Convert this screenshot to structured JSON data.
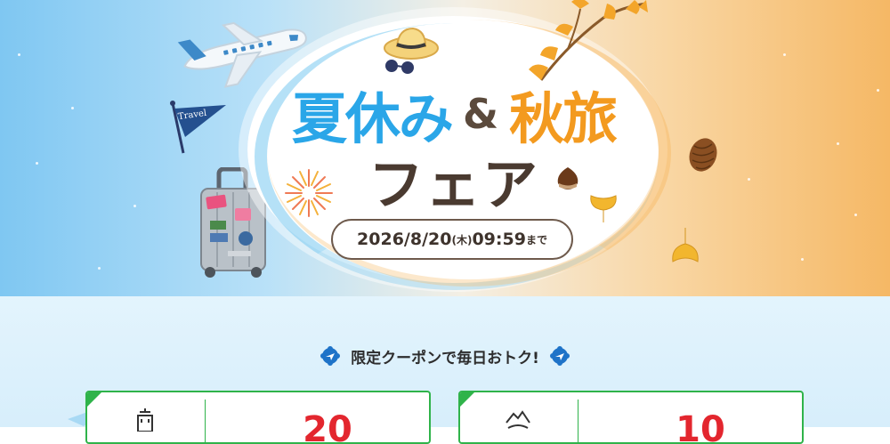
{
  "hero": {
    "title_part1": "夏休み",
    "title_amp": "&",
    "title_part2": "秋旅",
    "title_line2": "フェア",
    "date_main": "2026/8/20",
    "date_weekday": "(木)",
    "date_time": "09:59",
    "date_suffix": "まで",
    "flag_label": "Travel",
    "colors": {
      "blue": "#2aa6e8",
      "orange": "#f39a1f",
      "brown": "#4a3a30"
    }
  },
  "coupon_section": {
    "tagline": "限定クーポンで毎日おトク!",
    "accent_color": "#2fb34a",
    "amount_color": "#e3262e",
    "cards": [
      {
        "icon": "hotel-icon",
        "amount": "20"
      },
      {
        "icon": "mountain-onsen-icon",
        "amount": "10"
      }
    ]
  }
}
